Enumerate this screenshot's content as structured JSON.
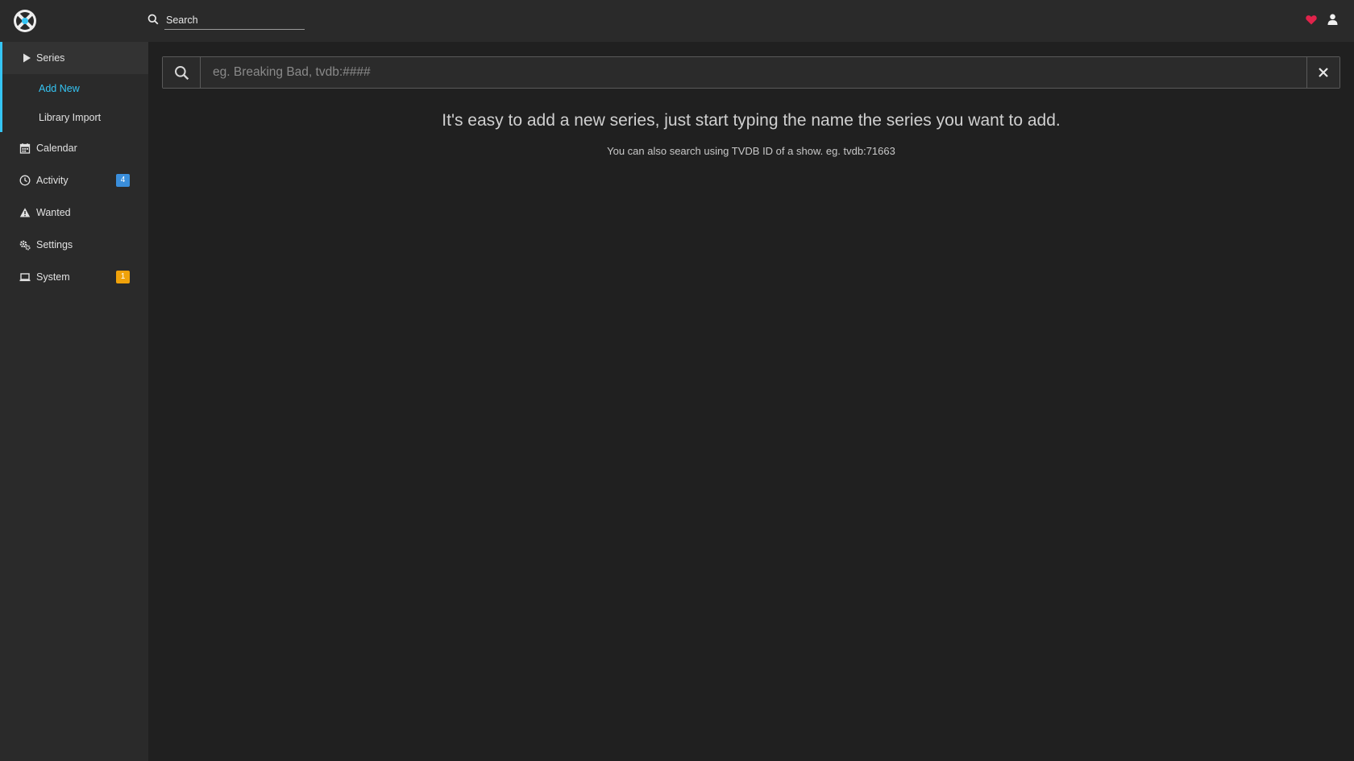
{
  "header": {
    "search_label": "Search"
  },
  "sidebar": {
    "items": [
      {
        "label": "Series",
        "icon": "play-icon"
      },
      {
        "label": "Calendar",
        "icon": "calendar-icon"
      },
      {
        "label": "Activity",
        "icon": "clock-icon",
        "badge": "4",
        "badge_color": "#3a8edb"
      },
      {
        "label": "Wanted",
        "icon": "warning-icon"
      },
      {
        "label": "Settings",
        "icon": "cogs-icon"
      },
      {
        "label": "System",
        "icon": "laptop-icon",
        "badge": "1",
        "badge_color": "#f0a20a"
      }
    ],
    "series_sub": [
      {
        "label": "Add New",
        "active": true
      },
      {
        "label": "Library Import"
      }
    ]
  },
  "main": {
    "search_placeholder": "eg. Breaking Bad, tvdb:####",
    "hint_title": "It's easy to add a new series, just start typing the name the series you want to add.",
    "hint_sub": "You can also search using TVDB ID of a show. eg. tvdb:71663"
  },
  "colors": {
    "accent": "#35c5f4",
    "header_bg": "#2a2a2a",
    "page_bg": "#202020",
    "heart": "#e1234b"
  }
}
